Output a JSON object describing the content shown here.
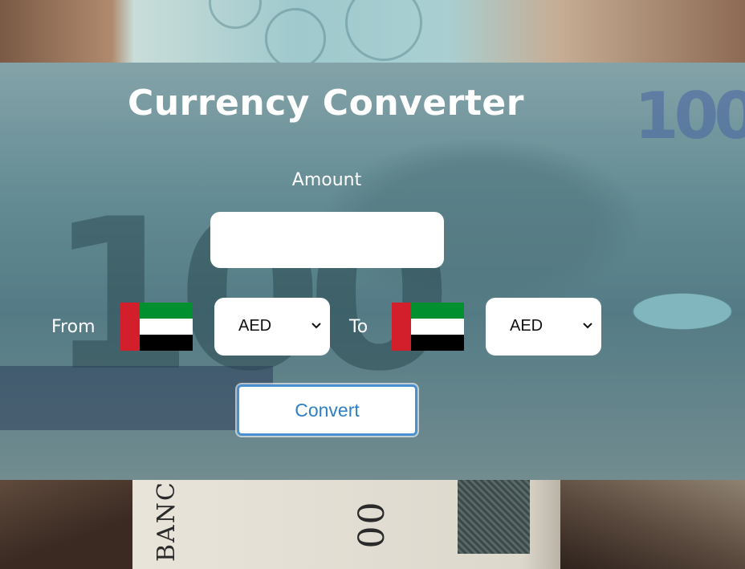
{
  "title": "Currency Converter",
  "amount": {
    "label": "Amount",
    "value": "",
    "placeholder": ""
  },
  "from": {
    "label": "From",
    "flag_icon": "uae-flag-icon",
    "selected": "AED"
  },
  "to": {
    "label": "To",
    "flag_icon": "uae-flag-icon",
    "selected": "AED"
  },
  "convert_label": "Convert",
  "colors": {
    "button_border": "#4a90d0",
    "button_text": "#2f7fc4",
    "flag_red": "#d21f2b",
    "flag_green": "#00902f",
    "flag_white": "#ffffff",
    "flag_black": "#000000"
  }
}
